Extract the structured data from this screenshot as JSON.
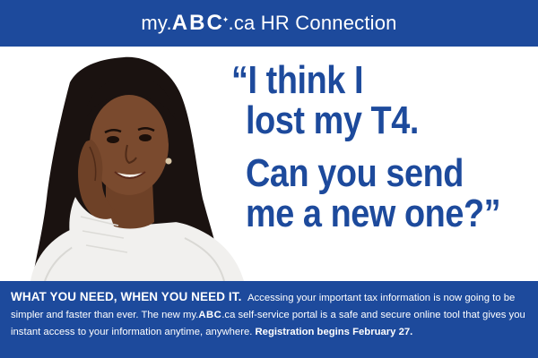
{
  "header": {
    "title_prefix": "my.",
    "title_brand": "ABC",
    "title_suffix": ".ca HR Connection"
  },
  "quote": {
    "line1": "“I think I",
    "line2": "lost my T4.",
    "line3": "Can you send",
    "line4": "me a new one?”"
  },
  "footer": {
    "heading": "WHAT YOU NEED, WHEN YOU NEED IT.",
    "text1": "Accessing your important tax information is now going to be simpler and faster than ever. The new my.",
    "brand": "ABC",
    "text2": ".ca self-service portal is a safe and secure online tool that gives you instant access to your information anytime, anywhere.",
    "registration": "Registration begins February 27."
  },
  "colors": {
    "brand_blue": "#1d4a9c",
    "white": "#ffffff"
  }
}
